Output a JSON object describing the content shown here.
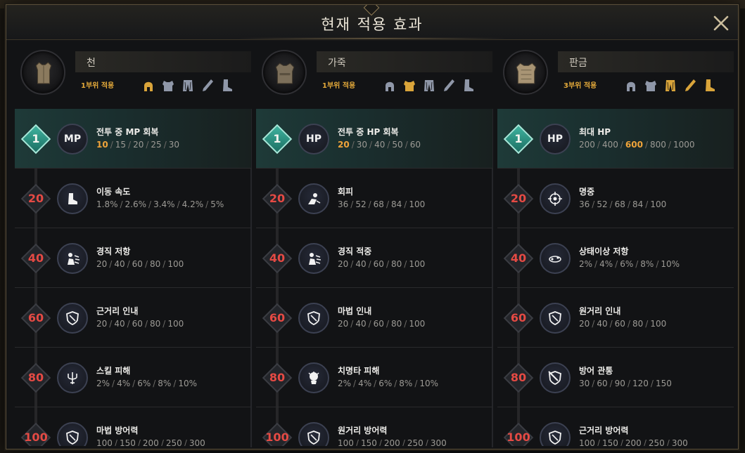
{
  "title": "현재 적용 효과",
  "columns": [
    {
      "set_name": "천",
      "set_count": "1부위 적용",
      "emblem_icon": "cloth-armor-icon",
      "pieces": [
        {
          "icon": "helmet-icon",
          "active": true
        },
        {
          "icon": "chest-icon",
          "active": false
        },
        {
          "icon": "legs-icon",
          "active": false
        },
        {
          "icon": "gloves-icon",
          "active": false
        },
        {
          "icon": "boots-icon",
          "active": false
        }
      ],
      "tiers": [
        {
          "level": "1",
          "icon_label": "MP",
          "name": "전투 중 MP 회복",
          "values": [
            "10",
            "15",
            "20",
            "25",
            "30"
          ],
          "current": 0
        },
        {
          "level": "20",
          "icon": "boot-icon",
          "name": "이동 속도",
          "values": [
            "1.8%",
            "2.6%",
            "3.4%",
            "4.2%",
            "5%"
          ]
        },
        {
          "level": "40",
          "icon": "stagger-icon",
          "name": "경직 저항",
          "values": [
            "20",
            "40",
            "60",
            "80",
            "100"
          ]
        },
        {
          "level": "60",
          "icon": "shield-icon",
          "name": "근거리 인내",
          "values": [
            "20",
            "40",
            "60",
            "80",
            "100"
          ]
        },
        {
          "level": "80",
          "icon": "trident-icon",
          "name": "스킬 피해",
          "values": [
            "2%",
            "4%",
            "6%",
            "8%",
            "10%"
          ]
        },
        {
          "level": "100",
          "icon": "shield-icon",
          "name": "마법 방어력",
          "values": [
            "100",
            "150",
            "200",
            "250",
            "300"
          ]
        }
      ]
    },
    {
      "set_name": "가죽",
      "set_count": "1부위 적용",
      "emblem_icon": "leather-armor-icon",
      "pieces": [
        {
          "icon": "helmet-icon",
          "active": false
        },
        {
          "icon": "chest-icon",
          "active": true
        },
        {
          "icon": "legs-icon",
          "active": false
        },
        {
          "icon": "gloves-icon",
          "active": false
        },
        {
          "icon": "boots-icon",
          "active": false
        }
      ],
      "tiers": [
        {
          "level": "1",
          "icon_label": "HP",
          "name": "전투 중 HP 회복",
          "values": [
            "20",
            "30",
            "40",
            "50",
            "60"
          ],
          "current": 0
        },
        {
          "level": "20",
          "icon": "dodge-icon",
          "name": "회피",
          "values": [
            "36",
            "52",
            "68",
            "84",
            "100"
          ]
        },
        {
          "level": "40",
          "icon": "stagger-icon",
          "name": "경직 적중",
          "values": [
            "20",
            "40",
            "60",
            "80",
            "100"
          ]
        },
        {
          "level": "60",
          "icon": "shield-icon",
          "name": "마법 인내",
          "values": [
            "20",
            "40",
            "60",
            "80",
            "100"
          ]
        },
        {
          "level": "80",
          "icon": "critical-icon",
          "name": "치명타 피해",
          "values": [
            "2%",
            "4%",
            "6%",
            "8%",
            "10%"
          ]
        },
        {
          "level": "100",
          "icon": "shield-icon",
          "name": "원거리 방어력",
          "values": [
            "100",
            "150",
            "200",
            "250",
            "300"
          ]
        }
      ]
    },
    {
      "set_name": "판금",
      "set_count": "3부위 적용",
      "emblem_icon": "plate-armor-icon",
      "pieces": [
        {
          "icon": "helmet-icon",
          "active": false
        },
        {
          "icon": "chest-icon",
          "active": false
        },
        {
          "icon": "legs-icon",
          "active": true
        },
        {
          "icon": "gloves-icon",
          "active": true
        },
        {
          "icon": "boots-icon",
          "active": true
        }
      ],
      "tiers": [
        {
          "level": "1",
          "icon_label": "HP",
          "name": "최대 HP",
          "values": [
            "200",
            "400",
            "600",
            "800",
            "1000"
          ],
          "current": 2
        },
        {
          "level": "20",
          "icon": "crosshair-icon",
          "name": "명중",
          "values": [
            "36",
            "52",
            "68",
            "84",
            "100"
          ]
        },
        {
          "level": "40",
          "icon": "status-icon",
          "name": "상태이상 저항",
          "values": [
            "2%",
            "4%",
            "6%",
            "8%",
            "10%"
          ]
        },
        {
          "level": "60",
          "icon": "shield-icon",
          "name": "원거리 인내",
          "values": [
            "20",
            "40",
            "60",
            "80",
            "100"
          ]
        },
        {
          "level": "80",
          "icon": "pierce-shield-icon",
          "name": "방어 관통",
          "values": [
            "30",
            "60",
            "90",
            "120",
            "150"
          ]
        },
        {
          "level": "100",
          "icon": "shield-icon",
          "name": "근거리 방어력",
          "values": [
            "100",
            "150",
            "200",
            "250",
            "300"
          ]
        }
      ]
    }
  ],
  "colors": {
    "accent_gold": "#f0a43a",
    "tier_red": "#e54a44",
    "active_teal": "#3fb39f"
  }
}
